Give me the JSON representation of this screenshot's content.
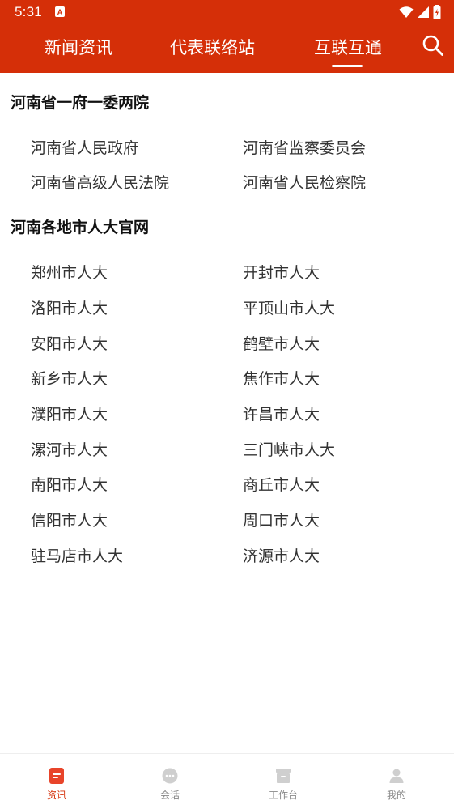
{
  "status_bar": {
    "time": "5:31",
    "notification_badge": "A"
  },
  "colors": {
    "primary": "#d52f08",
    "inactive": "#c8c8c8",
    "text": "#333333"
  },
  "tabs": [
    {
      "label": "新闻资讯"
    },
    {
      "label": "代表联络站"
    },
    {
      "label": "互联互通"
    }
  ],
  "active_tab": "互联互通",
  "sections": [
    {
      "title": "河南省一府一委两院",
      "links": [
        "河南省人民政府",
        "河南省监察委员会",
        "河南省高级人民法院",
        "河南省人民检察院"
      ]
    },
    {
      "title": "河南各地市人大官网",
      "links": [
        "郑州市人大",
        "开封市人大",
        "洛阳市人大",
        "平顶山市人大",
        "安阳市人大",
        "鹤壁市人大",
        "新乡市人大",
        "焦作市人大",
        "濮阳市人大",
        "许昌市人大",
        "漯河市人大",
        "三门峡市人大",
        "南阳市人大",
        "商丘市人大",
        "信阳市人大",
        "周口市人大",
        "驻马店市人大",
        "济源市人大"
      ]
    }
  ],
  "bottom_nav": [
    {
      "label": "资讯",
      "icon": "news-icon",
      "active": true
    },
    {
      "label": "会话",
      "icon": "chat-icon",
      "active": false
    },
    {
      "label": "工作台",
      "icon": "workbench-icon",
      "active": false
    },
    {
      "label": "我的",
      "icon": "user-icon",
      "active": false
    }
  ]
}
